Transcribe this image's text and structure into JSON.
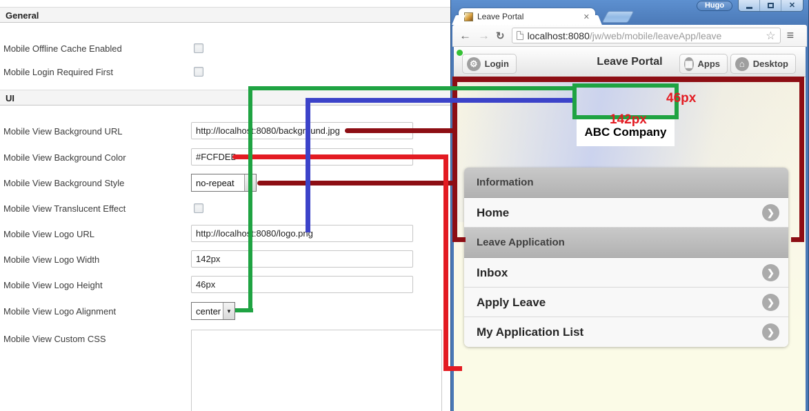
{
  "left_panel": {
    "sections": {
      "general": "General",
      "ui": "UI"
    },
    "fields": {
      "offline_cache": {
        "label": "Mobile Offline Cache Enabled",
        "checked": false
      },
      "login_required": {
        "label": "Mobile Login Required First",
        "checked": false
      },
      "bg_url": {
        "label": "Mobile View Background URL",
        "value": "http://localhost:8080/background.jpg"
      },
      "bg_color": {
        "label": "Mobile View Background Color",
        "value": "#FCFDED"
      },
      "bg_style": {
        "label": "Mobile View Background Style",
        "value": "no-repeat"
      },
      "translucent": {
        "label": "Mobile View Translucent Effect",
        "checked": false
      },
      "logo_url": {
        "label": "Mobile View Logo URL",
        "value": "http://localhost:8080/logo.png"
      },
      "logo_width": {
        "label": "Mobile View Logo Width",
        "value": "142px"
      },
      "logo_height": {
        "label": "Mobile View Logo Height",
        "value": "46px"
      },
      "logo_alignment": {
        "label": "Mobile View Logo Alignment",
        "value": "center"
      },
      "custom_css": {
        "label": "Mobile View Custom CSS",
        "value": ""
      }
    }
  },
  "browser": {
    "profile_name": "Hugo",
    "tab_title": "Leave Portal",
    "tab_close": "✕",
    "url_host": "localhost:8080",
    "url_path": "/jw/web/mobile/leaveApp/leave",
    "back": "←",
    "forward": "→",
    "reload": "↻",
    "star": "☆",
    "menu": "≡",
    "close_glyph": "✕"
  },
  "mobile": {
    "header": {
      "login_label": "Login",
      "title": "Leave Portal",
      "apps_label": "Apps",
      "desktop_label": "Desktop",
      "gear_glyph": "⚙",
      "grid_glyph": "▦",
      "home_glyph": "⌂"
    },
    "logo_text": "ABC Company",
    "chevron_glyph": "❯",
    "list": [
      {
        "type": "group",
        "label": "Information"
      },
      {
        "type": "item",
        "label": "Home"
      },
      {
        "type": "group",
        "label": "Leave Application"
      },
      {
        "type": "item",
        "label": "Inbox"
      },
      {
        "type": "item",
        "label": "Apply Leave"
      },
      {
        "type": "item",
        "label": "My Application List"
      }
    ]
  },
  "annotations": {
    "logo_height_label": "46px",
    "logo_width_label": "142px"
  },
  "colors": {
    "annotation_green": "#1fa342",
    "annotation_blue": "#3c43c9",
    "annotation_red": "#e31b22",
    "annotation_darkred": "#8d0e14",
    "chrome_frame": "#4a78b6",
    "chrome_frame_light": "#5d90d0",
    "status_green": "#35c135",
    "mobile_background_color": "#FCFDED"
  }
}
